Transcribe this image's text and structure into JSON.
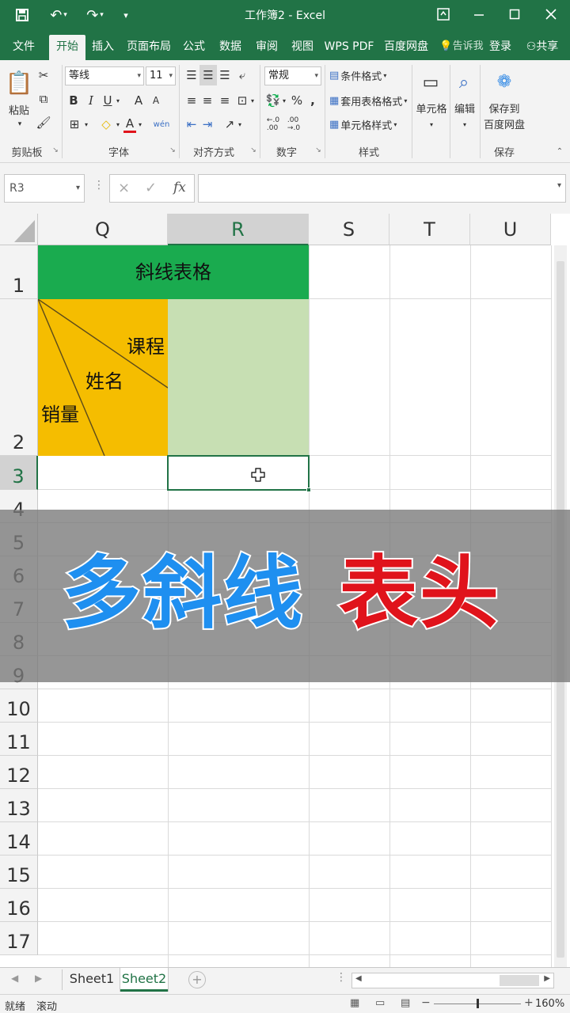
{
  "window": {
    "title": "工作簿2 - Excel",
    "quick_access": {
      "save_icon": "save-icon",
      "undo_icon": "undo-icon",
      "redo_icon": "redo-icon",
      "customize_icon": "customize-icon"
    },
    "controls": {
      "ribbon_display": "ribbon-display-icon",
      "minimize": "minimize-icon",
      "maximize": "maximize-icon",
      "close": "close-icon"
    }
  },
  "menu": {
    "tabs": [
      "文件",
      "开始",
      "插入",
      "页面布局",
      "公式",
      "数据",
      "审阅",
      "视图",
      "WPS PDF",
      "百度网盘"
    ],
    "active_tab": "开始",
    "tell_me": "告诉我",
    "login": "登录",
    "share": "共享"
  },
  "ribbon": {
    "clipboard": {
      "paste": "粘贴",
      "label": "剪贴板"
    },
    "font": {
      "name": "等线",
      "size": "11",
      "bold": "B",
      "italic": "I",
      "underline": "U",
      "grow": "A",
      "shrink": "A",
      "font_color": "A",
      "phonetic": "wén",
      "label": "字体"
    },
    "alignment": {
      "label": "对齐方式"
    },
    "number": {
      "format": "常规",
      "percent": "%",
      "comma": ",",
      "label": "数字"
    },
    "styles": {
      "conditional": "条件格式",
      "table": "套用表格格式",
      "cell_styles": "单元格样式",
      "label": "样式"
    },
    "cells": {
      "label": "单元格"
    },
    "editing": {
      "label": "编辑"
    },
    "save": {
      "line1": "保存到",
      "line2": "百度网盘",
      "label": "保存"
    }
  },
  "formula_bar": {
    "name_box": "R3",
    "cancel": "×",
    "enter": "✓",
    "fx": "fx",
    "content": ""
  },
  "grid": {
    "columns": [
      "Q",
      "R",
      "S",
      "T",
      "U"
    ],
    "selected_column": "R",
    "rows": [
      "1",
      "2",
      "3",
      "4",
      "5",
      "6",
      "7",
      "8",
      "9",
      "10",
      "11",
      "12",
      "13",
      "14",
      "15",
      "16",
      "17"
    ],
    "selected_row": "3",
    "title_cell": "斜线表格",
    "diagonal_labels": {
      "course": "课程",
      "name": "姓名",
      "sales": "销量"
    },
    "colors": {
      "title_bg": "#1aab4f",
      "header_bg": "#f5bd00",
      "data_bg": "#c7dfb3",
      "selection": "#217346"
    }
  },
  "banner": {
    "part1": "多斜线",
    "part2": "表头",
    "colors": {
      "part1": "#1e8ff0",
      "part2": "#e0131b"
    }
  },
  "sheets": {
    "tabs": [
      "Sheet1",
      "Sheet2"
    ],
    "active": "Sheet2"
  },
  "status": {
    "ready": "就绪",
    "scroll": "滚动",
    "zoom": "160%"
  }
}
